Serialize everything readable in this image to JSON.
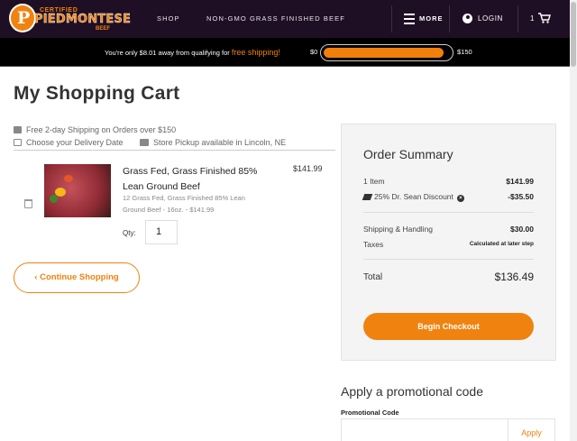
{
  "header": {
    "logo": {
      "top": "CERTIFIED",
      "main": "PIEDMONTESE",
      "sub": "BEEF",
      "badge": "P"
    },
    "nav": [
      "SHOP",
      "NON-GMO GRASS FINISHED BEEF"
    ],
    "more_label": "MORE",
    "login_label": "LOGIN",
    "cart_count": "1"
  },
  "shipping_bar": {
    "message_prefix": "You're only $8.01 away from qualifying for",
    "message_highlight": "free shipping!",
    "min_label": "$0",
    "max_label": "$150",
    "progress_fraction": 0.947,
    "accent_color": "#f0820f"
  },
  "page": {
    "title": "My Shopping Cart",
    "info": [
      {
        "icon": "truck-icon",
        "text": "Free 2-day Shipping on Orders over $150"
      },
      {
        "icon": "calendar-icon",
        "text": "Choose your Delivery Date"
      },
      {
        "icon": "cart-icon",
        "text": "Store Pickup available in Lincoln, NE"
      }
    ]
  },
  "cart": {
    "items": [
      {
        "name": "Grass Fed, Grass Finished 85% Lean Ground Beef",
        "description": "12 Grass Fed, Grass Finished 85% Lean Ground Beef - 16oz. - $141.99",
        "price": "$141.99",
        "qty_label": "Qty:",
        "qty": "1"
      }
    ],
    "continue_label": "‹ Continue Shopping"
  },
  "summary": {
    "title": "Order Summary",
    "item_count_label": "1 Item",
    "item_count_value": "$141.99",
    "discount_label": "25% Dr. Sean Discount",
    "discount_value": "-$35.50",
    "shipping_label": "Shipping & Handling",
    "shipping_value": "$30.00",
    "taxes_label": "Taxes",
    "taxes_value": "Calculated at later step",
    "total_label": "Total",
    "total_value": "$136.49",
    "checkout_label": "Begin Checkout"
  },
  "promo": {
    "title": "Apply a promotional code",
    "field_label": "Promotional Code",
    "field_value": "",
    "apply_label": "Apply"
  }
}
